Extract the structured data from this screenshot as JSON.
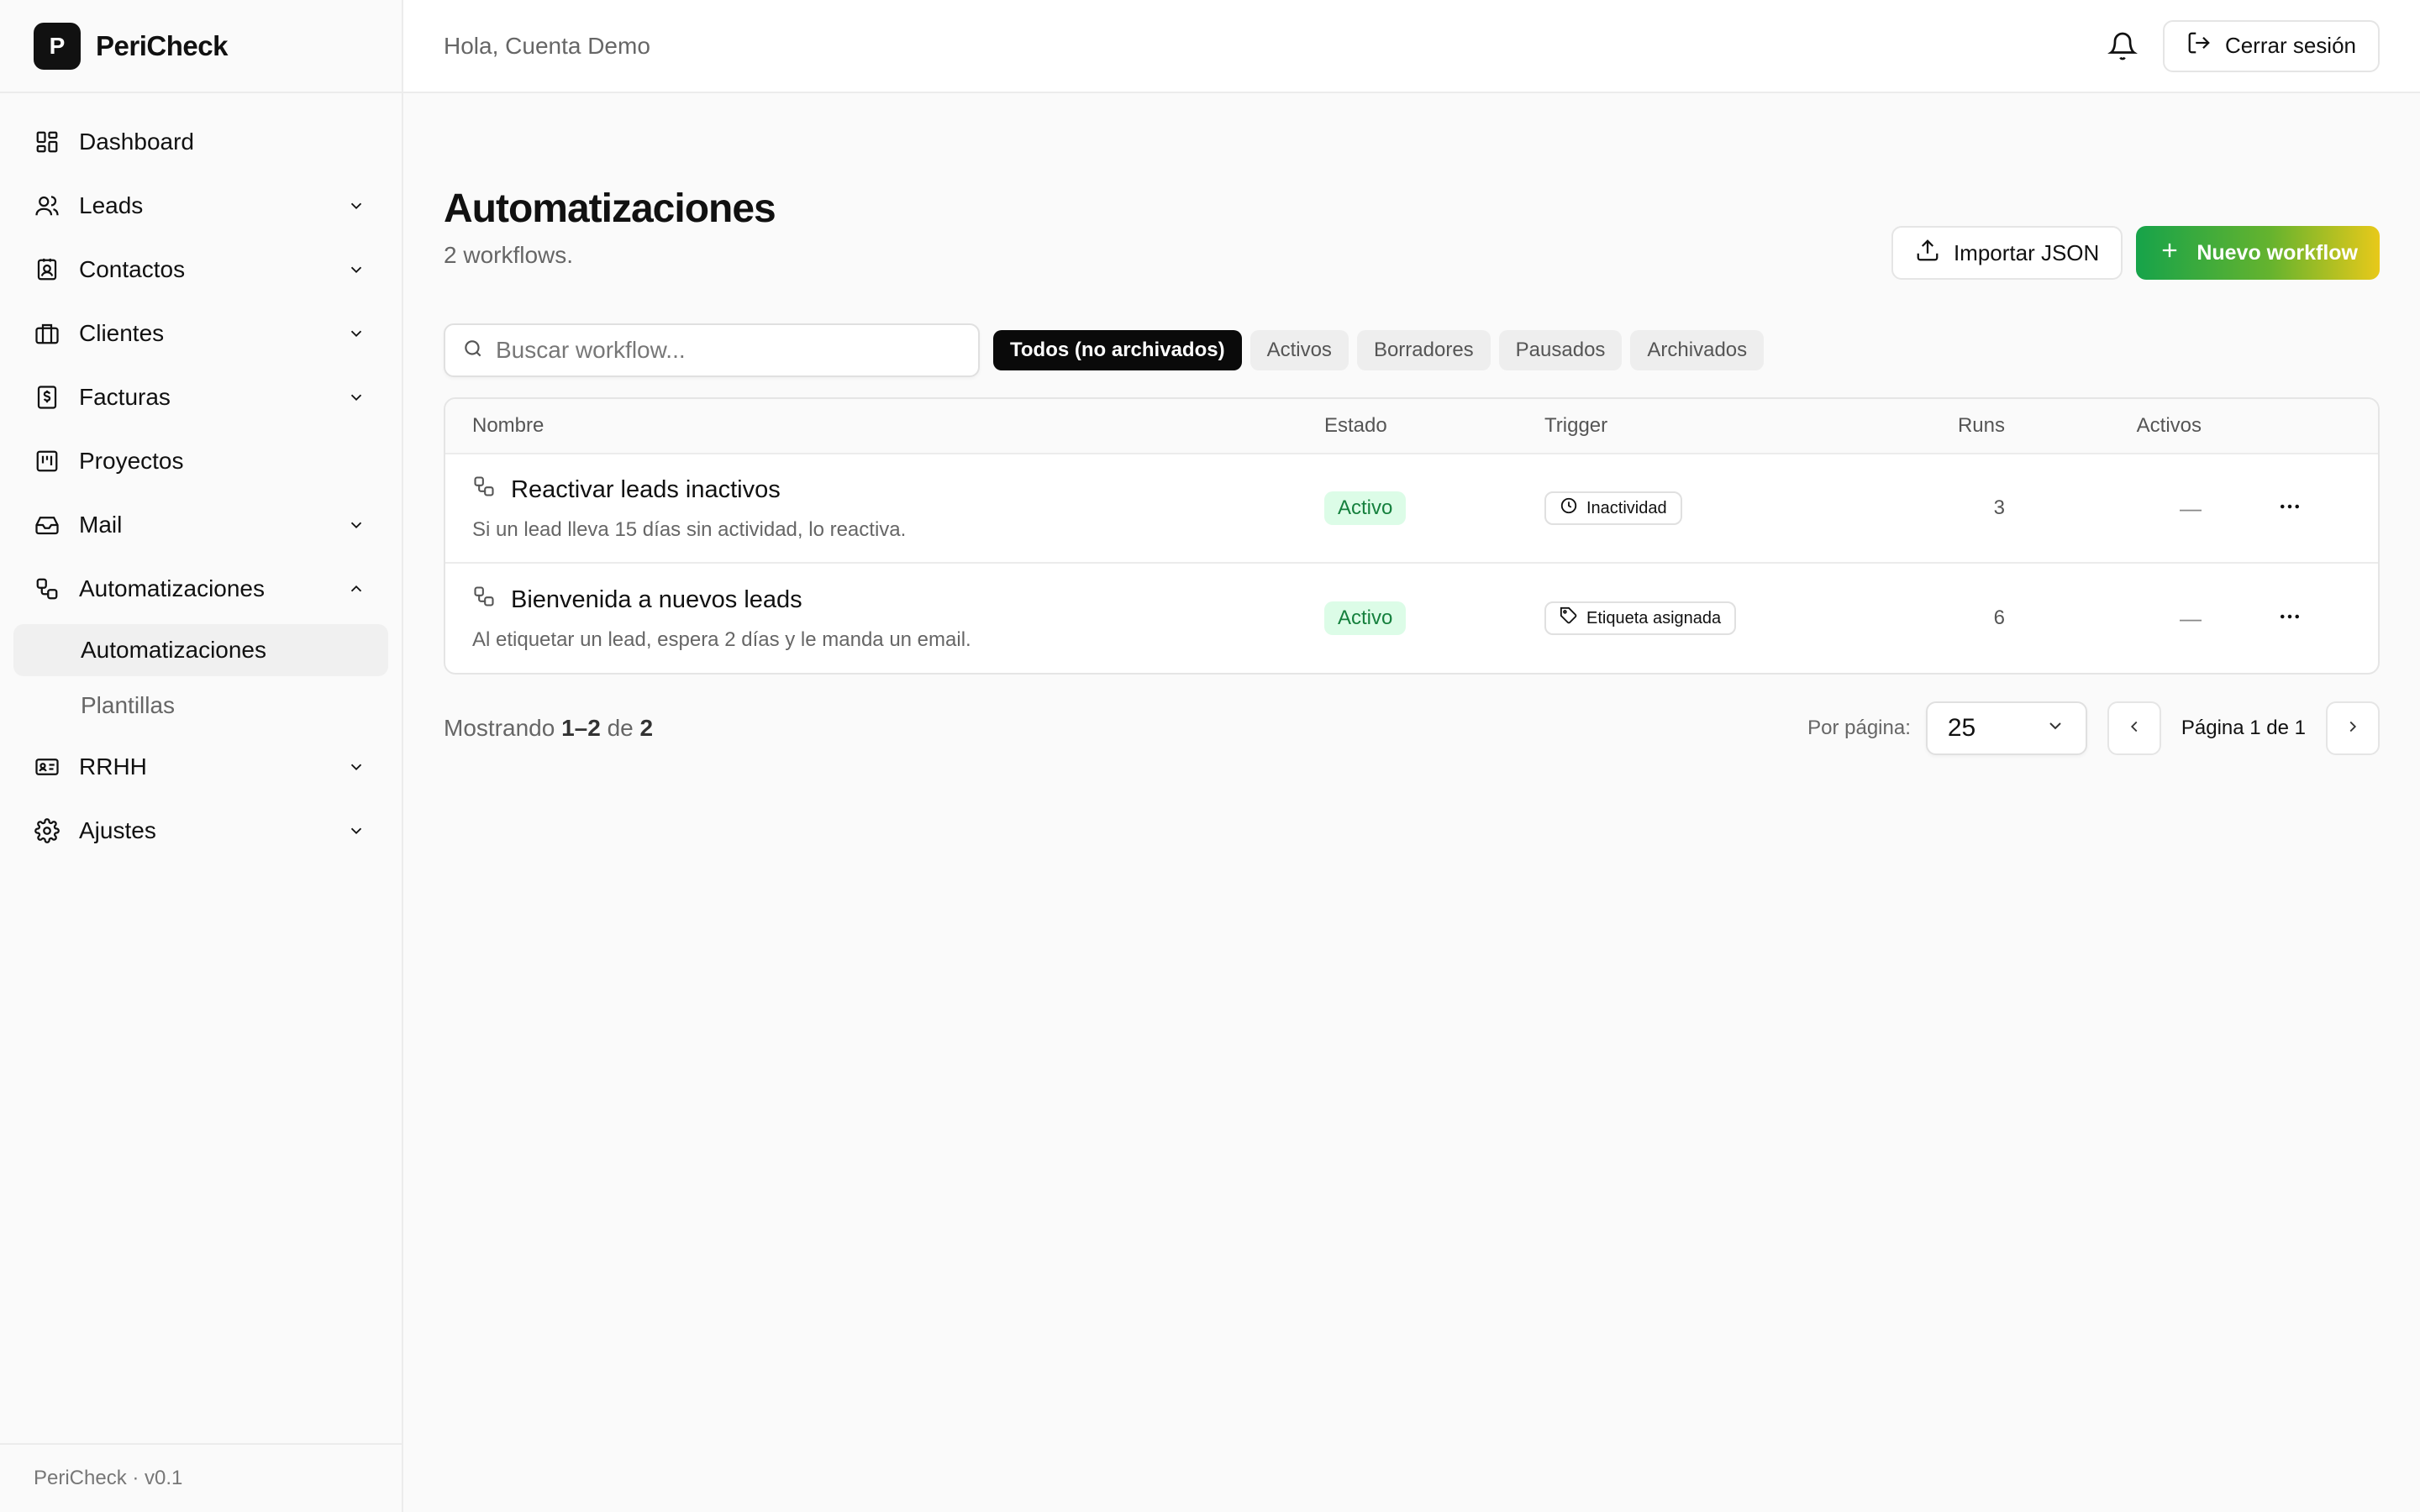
{
  "brand": {
    "logo_letter": "P",
    "name": "PeriCheck",
    "version": "PeriCheck · v0.1"
  },
  "sidebar": {
    "items": [
      {
        "label": "Dashboard",
        "icon": "dashboard-icon",
        "expandable": false
      },
      {
        "label": "Leads",
        "icon": "users-icon",
        "expandable": true
      },
      {
        "label": "Contactos",
        "icon": "contact-card-icon",
        "expandable": true
      },
      {
        "label": "Clientes",
        "icon": "briefcase-icon",
        "expandable": true
      },
      {
        "label": "Facturas",
        "icon": "invoice-icon",
        "expandable": true
      },
      {
        "label": "Proyectos",
        "icon": "kanban-icon",
        "expandable": false
      },
      {
        "label": "Mail",
        "icon": "inbox-icon",
        "expandable": true
      },
      {
        "label": "Automatizaciones",
        "icon": "workflow-icon",
        "expandable": true,
        "expanded": true
      },
      {
        "label": "RRHH",
        "icon": "id-card-icon",
        "expandable": true
      },
      {
        "label": "Ajustes",
        "icon": "gear-icon",
        "expandable": true
      }
    ],
    "subitems": [
      {
        "label": "Automatizaciones",
        "active": true
      },
      {
        "label": "Plantillas",
        "active": false
      }
    ]
  },
  "topbar": {
    "greeting": "Hola, Cuenta Demo",
    "logout_label": "Cerrar sesión"
  },
  "page": {
    "title": "Automatizaciones",
    "subtitle": "2 workflows.",
    "import_label": "Importar JSON",
    "new_label": "Nuevo workflow"
  },
  "search": {
    "placeholder": "Buscar workflow..."
  },
  "filters": [
    {
      "label": "Todos (no archivados)",
      "active": true
    },
    {
      "label": "Activos",
      "active": false
    },
    {
      "label": "Borradores",
      "active": false
    },
    {
      "label": "Pausados",
      "active": false
    },
    {
      "label": "Archivados",
      "active": false
    }
  ],
  "table": {
    "headers": {
      "name": "Nombre",
      "estado": "Estado",
      "trigger": "Trigger",
      "runs": "Runs",
      "activos": "Activos"
    },
    "rows": [
      {
        "name": "Reactivar leads inactivos",
        "description": "Si un lead lleva 15 días sin actividad, lo reactiva.",
        "status": "Activo",
        "trigger": "Inactividad",
        "trigger_icon": "clock-icon",
        "runs": "3",
        "activos": "—"
      },
      {
        "name": "Bienvenida a nuevos leads",
        "description": "Al etiquetar un lead, espera 2 días y le manda un email.",
        "status": "Activo",
        "trigger": "Etiqueta asignada",
        "trigger_icon": "tag-icon",
        "runs": "6",
        "activos": "—"
      }
    ]
  },
  "pagination": {
    "showing_prefix": "Mostrando",
    "range": "1–2",
    "of": "de",
    "total": "2",
    "per_page_label": "Por página:",
    "per_page_value": "25",
    "page_text": "Página 1 de 1"
  },
  "colors": {
    "accent_start": "#16a34a",
    "accent_end": "#e8c91a",
    "status_bg": "#dcfce7",
    "status_fg": "#15803d"
  }
}
